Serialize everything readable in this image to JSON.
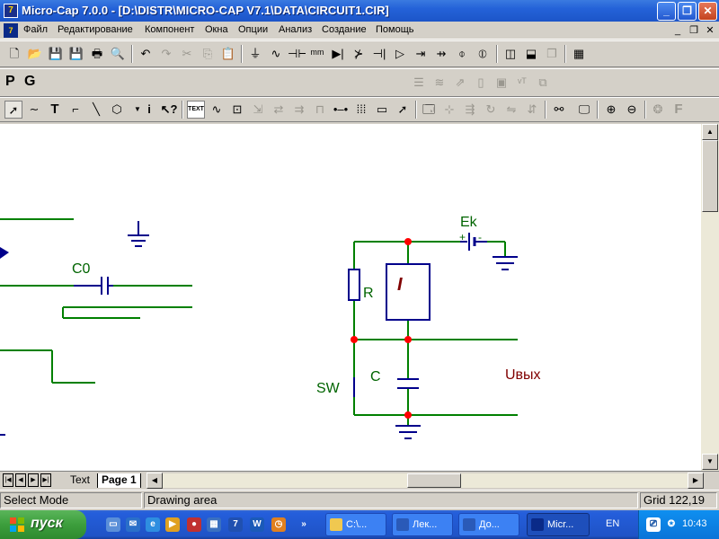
{
  "window": {
    "title": "Micro-Cap 7.0.0 - [D:\\DISTR\\MICRO-CAP V7.1\\DATA\\CIRCUIT1.CIR]",
    "app_icon_text": "7"
  },
  "menu": {
    "items": [
      "Файл",
      "Редактирование",
      "Компонент",
      "Окна",
      "Опции",
      "Анализ",
      "Создание",
      "Помощь"
    ]
  },
  "toolbar": {
    "mode_letters": [
      "P",
      "G"
    ],
    "text_tool_label": "TEXT"
  },
  "schematic": {
    "labels": {
      "c0": "C0",
      "ek": "Ek",
      "r": "R",
      "i": "I",
      "sw": "SW",
      "c": "C",
      "uout": "Uвых",
      "plus": "+",
      "minus": "-"
    },
    "colors": {
      "wire": "#008000",
      "component": "#00008b",
      "junction": "#ff0000",
      "label_green": "#006400",
      "label_red": "#800000"
    }
  },
  "tabs": {
    "items": [
      "Text",
      "Page 1"
    ],
    "active": "Page 1"
  },
  "status": {
    "mode": "Select Mode",
    "area": "Drawing area",
    "grid": "Grid 122,19"
  },
  "taskbar": {
    "start_label": "пуск",
    "tasks": [
      "C:\\...",
      "Лек...",
      "До...",
      "Micr..."
    ],
    "lang": "EN",
    "clock": "10:43"
  }
}
